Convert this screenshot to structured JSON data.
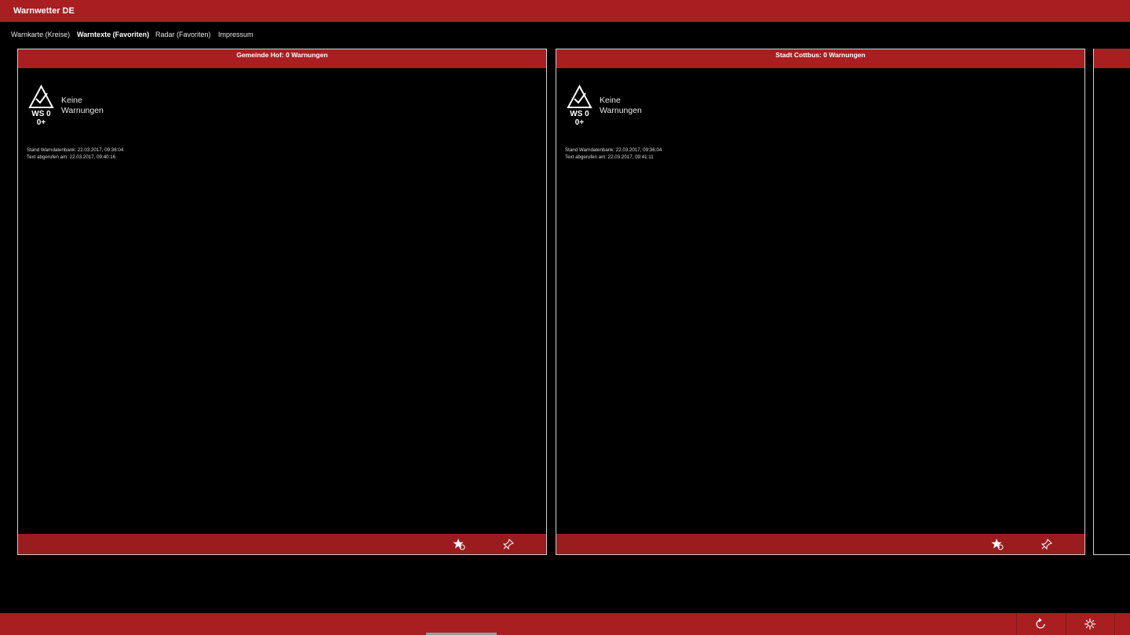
{
  "app": {
    "title": "Warnwetter DE"
  },
  "nav": {
    "tabs": [
      {
        "label": "Warnkarte (Kreise)",
        "active": false
      },
      {
        "label": "Warntexte (Favoriten)",
        "active": true
      },
      {
        "label": "Radar (Favoriten)",
        "active": false
      },
      {
        "label": "Impressum",
        "active": false
      }
    ]
  },
  "cards": [
    {
      "header": "Gemeinde Hof: 0 Warnungen",
      "ws_level": "WS 0",
      "ws_sub": "0+",
      "status_line1": "Keine",
      "status_line2": "Warnungen",
      "stand": "Stand Warndatenbank: 22.03.2017, 09:36:04",
      "abgerufen": "Text abgerufen am: 22.03.2017, 09:40:16"
    },
    {
      "header": "Stadt Cottbus: 0 Warnungen",
      "ws_level": "WS 0",
      "ws_sub": "0+",
      "status_line1": "Keine",
      "status_line2": "Warnungen",
      "stand": "Stand Warndatenbank: 22.03.2017, 09:36:04",
      "abgerufen": "Text abgerufen am: 22.03.2017, 09:41:11"
    }
  ],
  "icons": {
    "status": "check-triangle-icon",
    "favorite": "star-remove-icon",
    "pin": "pin-icon",
    "refresh": "refresh-icon",
    "settings": "settings-icon"
  },
  "colors": {
    "accent": "#a81e21",
    "footer": "#9b1c1f",
    "background": "#000000"
  }
}
